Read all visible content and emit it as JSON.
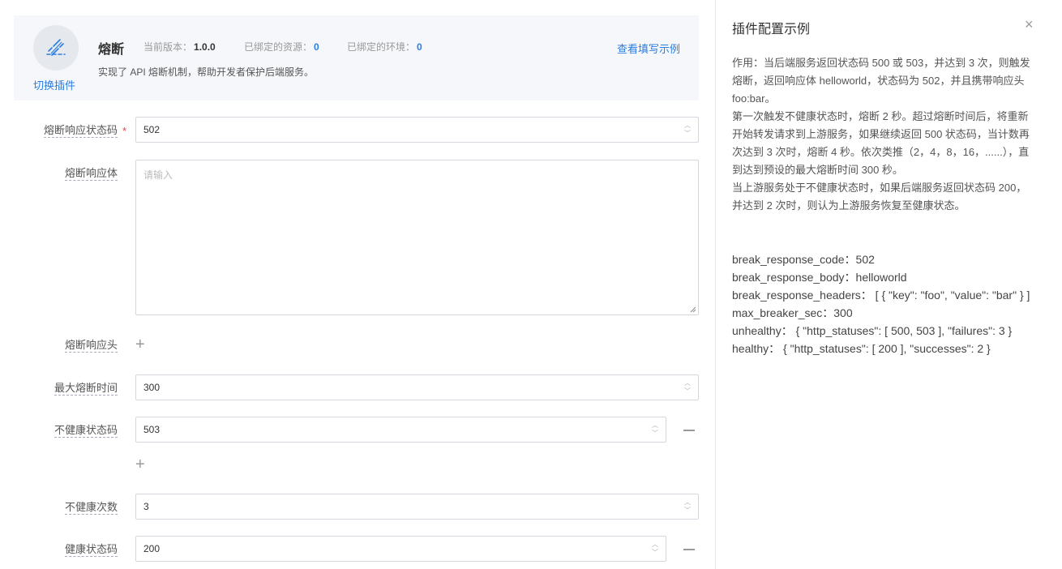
{
  "plugin": {
    "name": "熔断",
    "version_label": "当前版本：",
    "version": "1.0.0",
    "resources_label": "已绑定的资源：",
    "resources_count": "0",
    "envs_label": "已绑定的环境：",
    "envs_count": "0",
    "description": "实现了 API 熔断机制，帮助开发者保护后端服务。",
    "switch_label": "切换插件",
    "example_link": "查看填写示例"
  },
  "form": {
    "status_code": {
      "label": "熔断响应状态码",
      "value": "502"
    },
    "body": {
      "label": "熔断响应体",
      "placeholder": "请输入"
    },
    "headers": {
      "label": "熔断响应头"
    },
    "max_breaker": {
      "label": "最大熔断时间",
      "value": "300"
    },
    "unhealthy_status": {
      "label": "不健康状态码",
      "value": "503"
    },
    "unhealthy_count": {
      "label": "不健康次数",
      "value": "3"
    },
    "healthy_status": {
      "label": "健康状态码",
      "value": "200"
    }
  },
  "panel": {
    "title": "插件配置示例",
    "close": "×",
    "description": [
      "作用：当后端服务返回状态码 500 或 503，并达到 3 次，则触发熔断，返回响应体 helloworld，状态码为 502，并且携带响应头 foo:bar。",
      "第一次触发不健康状态时，熔断 2 秒。超过熔断时间后，将重新开始转发请求到上游服务，如果继续返回 500 状态码，当计数再次达到 3 次时，熔断 4 秒。依次类推（2，4，8，16，......），直到达到预设的最大熔断时间 300 秒。",
      "当上游服务处于不健康状态时，如果后端服务返回状态码 200，并达到 2 次时，则认为上游服务恢复至健康状态。"
    ],
    "code": [
      "break_response_code：502",
      "break_response_body：helloworld",
      "break_response_headers： [ { \"key\": \"foo\", \"value\": \"bar\" } ]",
      "max_breaker_sec：300",
      "unhealthy： { \"http_statuses\": [ 500, 503 ], \"failures\": 3 }",
      "healthy： { \"http_statuses\": [ 200 ], \"successes\": 2 }"
    ]
  }
}
